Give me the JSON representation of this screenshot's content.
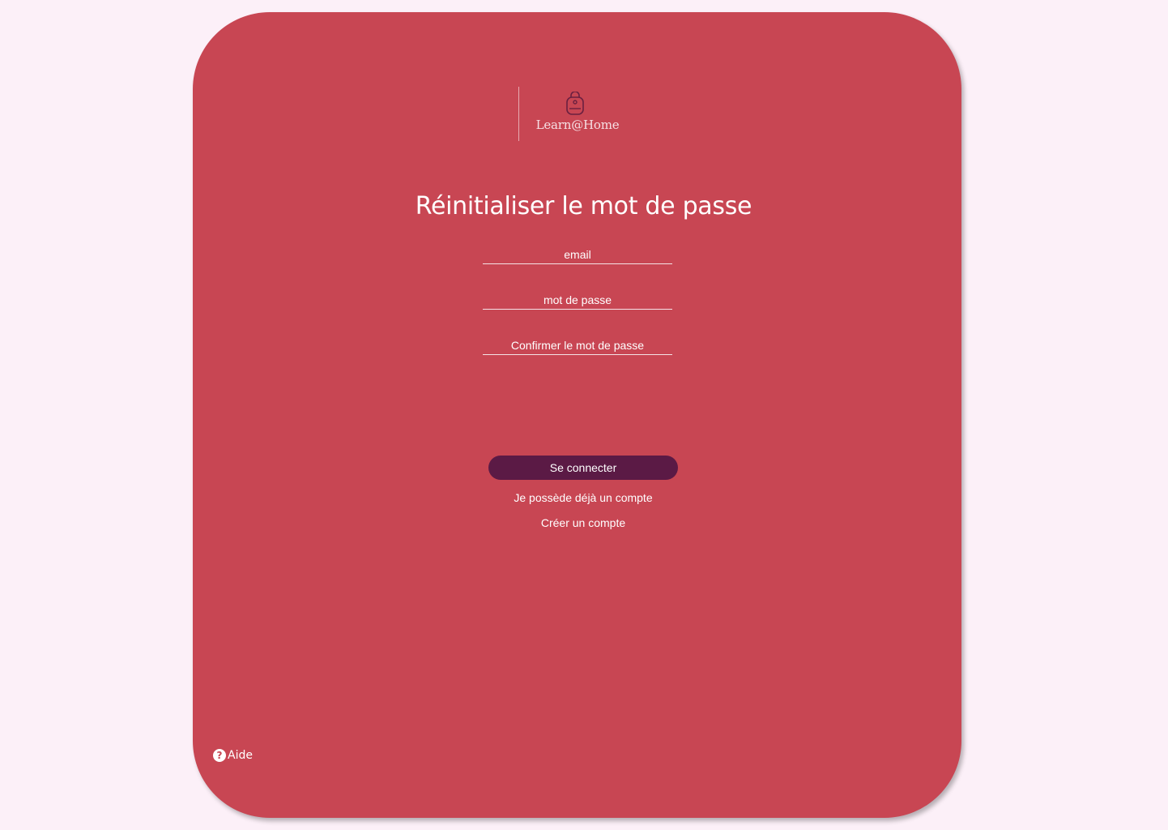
{
  "brand": {
    "name": "Learn@Home",
    "icon": "backpack-icon"
  },
  "page_title": "Réinitialiser le mot de passe",
  "form": {
    "email_placeholder": "email",
    "password_placeholder": "mot de passe",
    "confirm_placeholder": "Confirmer le mot de passe",
    "submit_label": "Se connecter"
  },
  "links": {
    "existing_account": "Je possède déjà un compte",
    "create_account": "Créer un compte"
  },
  "help": {
    "label": "Aide",
    "icon": "question-circle-icon"
  },
  "colors": {
    "background": "#fcf0f8",
    "card": "#c84653",
    "button": "#5b1a45"
  }
}
